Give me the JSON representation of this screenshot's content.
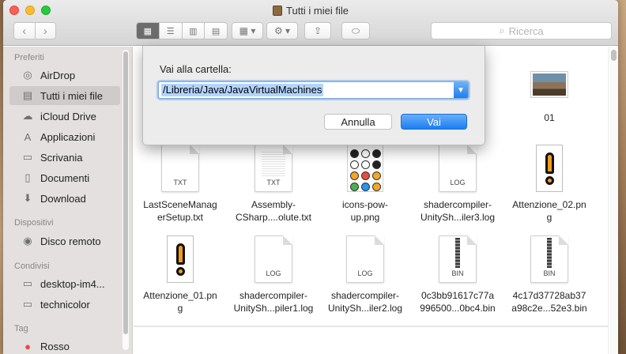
{
  "window": {
    "title": "Tutti i miei file"
  },
  "toolbar": {
    "search_placeholder": "Ricerca"
  },
  "sidebar": {
    "sections": [
      {
        "title": "Preferiti",
        "items": [
          {
            "label": "AirDrop",
            "icon": "airdrop-icon"
          },
          {
            "label": "Tutti i miei file",
            "icon": "all-files-icon",
            "selected": true
          },
          {
            "label": "iCloud Drive",
            "icon": "cloud-icon"
          },
          {
            "label": "Applicazioni",
            "icon": "applications-icon"
          },
          {
            "label": "Scrivania",
            "icon": "desktop-icon"
          },
          {
            "label": "Documenti",
            "icon": "document-icon"
          },
          {
            "label": "Download",
            "icon": "download-icon"
          }
        ]
      },
      {
        "title": "Dispositivi",
        "items": [
          {
            "label": "Disco remoto",
            "icon": "disc-icon"
          }
        ]
      },
      {
        "title": "Condivisi",
        "items": [
          {
            "label": "desktop-im4...",
            "icon": "monitor-icon"
          },
          {
            "label": "technicolor",
            "icon": "monitor-icon"
          }
        ]
      },
      {
        "title": "Tag",
        "items": [
          {
            "label": "Rosso",
            "icon": "red-tag-icon"
          }
        ]
      }
    ]
  },
  "files": {
    "row0": [
      {
        "name": "01",
        "kind": "photo"
      }
    ],
    "row1": [
      {
        "name": "LastSceneManagerSetup.txt",
        "line1": "LastSceneManag",
        "line2": "erSetup.txt",
        "ext": "TXT"
      },
      {
        "name": "Assembly-CSharp....olute.txt",
        "line1": "Assembly-",
        "line2": "CSharp....olute.txt",
        "ext": "TXT"
      },
      {
        "name": "icons-pow-up.png",
        "line1": "icons-pow-",
        "line2": "up.png"
      },
      {
        "name": "shadercompiler-UnitySh...iler3.log",
        "line1": "shadercompiler-",
        "line2": "UnitySh...iler3.log",
        "ext": "LOG"
      },
      {
        "name": "Attenzione_02.png",
        "line1": "Attenzione_02.pn",
        "line2": "g"
      }
    ],
    "row2": [
      {
        "name": "Attenzione_01.png",
        "line1": "Attenzione_01.pn",
        "line2": "g"
      },
      {
        "name": "shadercompiler-UnitySh...piler1.log",
        "line1": "shadercompiler-",
        "line2": "UnitySh...piler1.log",
        "ext": "LOG"
      },
      {
        "name": "shadercompiler-UnitySh...iler2.log",
        "line1": "shadercompiler-",
        "line2": "UnitySh...iler2.log",
        "ext": "LOG"
      },
      {
        "name": "0c3bb91617c77a996500...0bc4.bin",
        "line1": "0c3bb91617c77a",
        "line2": "996500...0bc4.bin",
        "ext": "BIN"
      },
      {
        "name": "4c17d37728ab37a98c2e...52e3.bin",
        "line1": "4c17d37728ab37",
        "line2": "a98c2e...52e3.bin",
        "ext": "BIN"
      }
    ]
  },
  "dialog": {
    "label": "Vai alla cartella:",
    "path": "/Libreria/Java/JavaVirtualMachines",
    "cancel": "Annulla",
    "confirm": "Vai"
  },
  "colors": {
    "accent": "#1b7ef0",
    "selection": "#b3d4fd"
  }
}
